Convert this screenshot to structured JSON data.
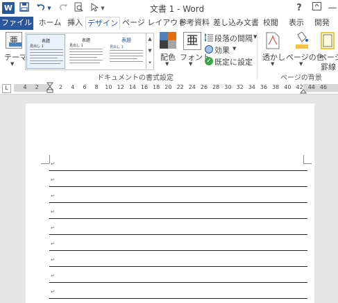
{
  "app": {
    "logo_letter": "W",
    "window_title": "文書 1 - Word",
    "accent_color": "#2b579a"
  },
  "quick_access": {
    "save_icon": "save-icon",
    "undo_icon": "undo-icon",
    "redo_icon": "redo-icon",
    "print_preview_icon": "print-preview-icon",
    "touch_mode_icon": "touch-mode-icon",
    "customize_icon": "chevron-down-icon"
  },
  "window_controls": {
    "help": "?",
    "ribbon_display": "ribbon-display-icon",
    "minimize": "minimize-icon",
    "restore": "restore-icon"
  },
  "tabs": [
    {
      "label": "ファイル"
    },
    {
      "label": "ホーム"
    },
    {
      "label": "挿入"
    },
    {
      "label": "デザイン"
    },
    {
      "label": "ページ レイアウト"
    },
    {
      "label": "参考資料"
    },
    {
      "label": "差し込み文書"
    },
    {
      "label": "校閲"
    },
    {
      "label": "表示"
    },
    {
      "label": "開発"
    }
  ],
  "active_tab": "デザイン",
  "ribbon": {
    "theme_label": "テーマ",
    "theme_glyph": "亜",
    "gallery_thumbs": [
      {
        "title": "表題",
        "heading": "見出し 1"
      },
      {
        "title": "表題",
        "heading": "見出し 1"
      },
      {
        "title": "表題",
        "heading": "見出し 1"
      }
    ],
    "doc_format_group": "ドキュメントの書式設定",
    "colors_label": "配色",
    "fonts_label": "フォント",
    "fonts_glyph": "亜",
    "paragraph_spacing_label": "段落の間隔",
    "effects_label": "効果",
    "set_default_label": "既定に設定",
    "watermark_label": "透かし",
    "page_color_label": "ページの色",
    "page_borders_label1": "ページ",
    "page_borders_label2": "罫線",
    "page_background_group": "ページの背景"
  },
  "ruler": {
    "corner": "L",
    "ticks": [
      "4",
      "2",
      "2",
      "4",
      "6",
      "8",
      "10",
      "12",
      "14",
      "16",
      "18",
      "20",
      "22",
      "24",
      "26",
      "28",
      "30",
      "32",
      "34",
      "36",
      "38",
      "40",
      "42",
      "44",
      "46"
    ]
  },
  "document": {
    "paragraph_mark": "↵",
    "rule_lines": 10
  }
}
